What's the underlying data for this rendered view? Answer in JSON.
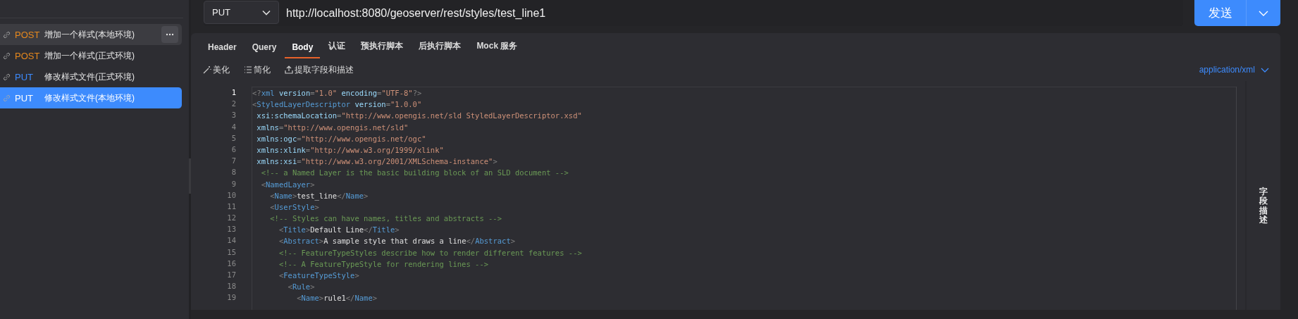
{
  "sidebar": {
    "items": [
      {
        "method": "POST",
        "name": "增加一个样式(本地环境)",
        "color": "#e8891d",
        "selected": false,
        "hovered": true
      },
      {
        "method": "POST",
        "name": "增加一个样式(正式环境)",
        "color": "#e8891d",
        "selected": false,
        "hovered": false
      },
      {
        "method": "PUT",
        "name": "修改样式文件(正式环境)",
        "color": "#3d8bfd",
        "selected": false,
        "hovered": false
      },
      {
        "method": "PUT",
        "name": "修改样式文件(本地环境)",
        "color": "#ffffff",
        "selected": true,
        "hovered": false
      }
    ]
  },
  "request": {
    "method": "PUT",
    "url": "http://localhost:8080/geoserver/rest/styles/test_line1",
    "send_label": "发送"
  },
  "tabs": [
    {
      "label": "Header",
      "selected": false
    },
    {
      "label": "Query",
      "selected": false
    },
    {
      "label": "Body",
      "selected": true
    },
    {
      "label": "认证",
      "selected": false
    },
    {
      "label": "预执行脚本",
      "selected": false
    },
    {
      "label": "后执行脚本",
      "selected": false
    },
    {
      "label": "Mock 服务",
      "selected": false
    }
  ],
  "toolbar": [
    {
      "kind": "beautify",
      "label": "美化"
    },
    {
      "kind": "simplify",
      "label": "简化"
    },
    {
      "kind": "extract",
      "label": "提取字段和描述"
    }
  ],
  "content_type": "application/xml",
  "editor": {
    "lines": [
      {
        "number": "1",
        "selected": true,
        "tokens": [
          {
            "kind": "p",
            "text": "<?"
          },
          {
            "kind": "tag",
            "text": "xml"
          },
          {
            "kind": "attr",
            "text": " version"
          },
          {
            "kind": "p",
            "text": "="
          },
          {
            "kind": "str",
            "text": "\"1.0\""
          },
          {
            "kind": "attr",
            "text": " encoding"
          },
          {
            "kind": "p",
            "text": "="
          },
          {
            "kind": "str",
            "text": "\"UTF-8\""
          },
          {
            "kind": "p",
            "text": "?>"
          }
        ]
      },
      {
        "number": "2",
        "selected": false,
        "tokens": [
          {
            "kind": "p",
            "text": "<"
          },
          {
            "kind": "tag",
            "text": "StyledLayerDescriptor"
          },
          {
            "kind": "attr",
            "text": " version"
          },
          {
            "kind": "p",
            "text": "="
          },
          {
            "kind": "str",
            "text": "\"1.0.0\""
          }
        ]
      },
      {
        "number": "3",
        "selected": false,
        "tokens": [
          {
            "kind": "attr",
            "text": " xsi:schemaLocation"
          },
          {
            "kind": "p",
            "text": "="
          },
          {
            "kind": "str",
            "text": "\"http://www.opengis.net/sld StyledLayerDescriptor.xsd\""
          }
        ]
      },
      {
        "number": "4",
        "selected": false,
        "tokens": [
          {
            "kind": "attr",
            "text": " xmlns"
          },
          {
            "kind": "p",
            "text": "="
          },
          {
            "kind": "str",
            "text": "\"http://www.opengis.net/sld\""
          }
        ]
      },
      {
        "number": "5",
        "selected": false,
        "tokens": [
          {
            "kind": "attr",
            "text": " xmlns:ogc"
          },
          {
            "kind": "p",
            "text": "="
          },
          {
            "kind": "str",
            "text": "\"http://www.opengis.net/ogc\""
          }
        ]
      },
      {
        "number": "6",
        "selected": false,
        "tokens": [
          {
            "kind": "attr",
            "text": " xmlns:xlink"
          },
          {
            "kind": "p",
            "text": "="
          },
          {
            "kind": "str",
            "text": "\"http://www.w3.org/1999/xlink\""
          }
        ]
      },
      {
        "number": "7",
        "selected": false,
        "tokens": [
          {
            "kind": "attr",
            "text": " xmlns:xsi"
          },
          {
            "kind": "p",
            "text": "="
          },
          {
            "kind": "str",
            "text": "\"http://www.w3.org/2001/XMLSchema-instance\""
          },
          {
            "kind": "p",
            "text": ">"
          }
        ]
      },
      {
        "number": "8",
        "selected": false,
        "tokens": [
          {
            "kind": "cm",
            "text": "  <!-- a Named Layer is the basic building block of an SLD document -->"
          }
        ]
      },
      {
        "number": "9",
        "selected": false,
        "tokens": [
          {
            "kind": "p",
            "text": "  <"
          },
          {
            "kind": "tag",
            "text": "NamedLayer"
          },
          {
            "kind": "p",
            "text": ">"
          }
        ]
      },
      {
        "number": "10",
        "selected": false,
        "tokens": [
          {
            "kind": "p",
            "text": "    <"
          },
          {
            "kind": "tag",
            "text": "Name"
          },
          {
            "kind": "p",
            "text": ">"
          },
          {
            "kind": "tx",
            "text": "test_line"
          },
          {
            "kind": "p",
            "text": "</"
          },
          {
            "kind": "tag",
            "text": "Name"
          },
          {
            "kind": "p",
            "text": ">"
          }
        ]
      },
      {
        "number": "11",
        "selected": false,
        "tokens": [
          {
            "kind": "p",
            "text": "    <"
          },
          {
            "kind": "tag",
            "text": "UserStyle"
          },
          {
            "kind": "p",
            "text": ">"
          }
        ]
      },
      {
        "number": "12",
        "selected": false,
        "tokens": [
          {
            "kind": "cm",
            "text": "    <!-- Styles can have names, titles and abstracts -->"
          }
        ]
      },
      {
        "number": "13",
        "selected": false,
        "tokens": [
          {
            "kind": "p",
            "text": "      <"
          },
          {
            "kind": "tag",
            "text": "Title"
          },
          {
            "kind": "p",
            "text": ">"
          },
          {
            "kind": "tx",
            "text": "Default Line"
          },
          {
            "kind": "p",
            "text": "</"
          },
          {
            "kind": "tag",
            "text": "Title"
          },
          {
            "kind": "p",
            "text": ">"
          }
        ]
      },
      {
        "number": "14",
        "selected": false,
        "tokens": [
          {
            "kind": "p",
            "text": "      <"
          },
          {
            "kind": "tag",
            "text": "Abstract"
          },
          {
            "kind": "p",
            "text": ">"
          },
          {
            "kind": "tx",
            "text": "A sample style that draws a line"
          },
          {
            "kind": "p",
            "text": "</"
          },
          {
            "kind": "tag",
            "text": "Abstract"
          },
          {
            "kind": "p",
            "text": ">"
          }
        ]
      },
      {
        "number": "15",
        "selected": false,
        "tokens": [
          {
            "kind": "cm",
            "text": "      <!-- FeatureTypeStyles describe how to render different features -->"
          }
        ]
      },
      {
        "number": "16",
        "selected": false,
        "tokens": [
          {
            "kind": "cm",
            "text": "      <!-- A FeatureTypeStyle for rendering lines -->"
          }
        ]
      },
      {
        "number": "17",
        "selected": false,
        "tokens": [
          {
            "kind": "p",
            "text": "      <"
          },
          {
            "kind": "tag",
            "text": "FeatureTypeStyle"
          },
          {
            "kind": "p",
            "text": ">"
          }
        ]
      },
      {
        "number": "18",
        "selected": false,
        "tokens": [
          {
            "kind": "p",
            "text": "        <"
          },
          {
            "kind": "tag",
            "text": "Rule"
          },
          {
            "kind": "p",
            "text": ">"
          }
        ]
      },
      {
        "number": "19",
        "selected": false,
        "tokens": [
          {
            "kind": "p",
            "text": "          <"
          },
          {
            "kind": "tag",
            "text": "Name"
          },
          {
            "kind": "p",
            "text": ">"
          },
          {
            "kind": "tx",
            "text": "rule1"
          },
          {
            "kind": "p",
            "text": "</"
          },
          {
            "kind": "tag",
            "text": "Name"
          },
          {
            "kind": "p",
            "text": ">"
          }
        ]
      }
    ]
  },
  "side_panel": {
    "label": "字段描述"
  }
}
